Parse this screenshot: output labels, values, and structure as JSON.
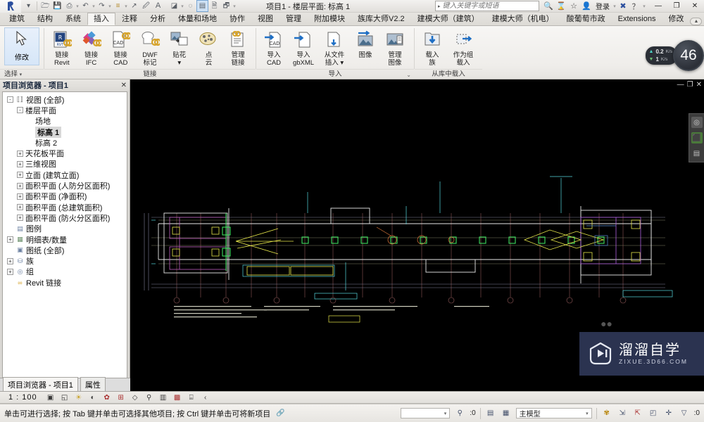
{
  "titlebar": {
    "logo": "revit-logo",
    "title": "项目1 - 楼层平面: 标高 1",
    "search_placeholder": "键入关键字或短语",
    "search_value": "",
    "signin_label": "登录",
    "qat_icons": [
      "open-icon",
      "save-icon",
      "print-icon",
      "undo-icon",
      "redo-icon",
      "measure-icon",
      "aligned-dimension-icon",
      "tag-icon",
      "text-icon",
      "section-icon",
      "thin-line-icon",
      "close-hidden-icon",
      "sync-icon",
      "switch-window-icon"
    ],
    "help_icon": "help-icon",
    "exchange_icon": "autodesk-exchange-icon",
    "window_buttons": [
      "minimize",
      "restore",
      "close"
    ]
  },
  "ribbon": {
    "tabs": [
      {
        "label": "建筑",
        "active": false
      },
      {
        "label": "结构",
        "active": false
      },
      {
        "label": "系统",
        "active": false
      },
      {
        "label": "插入",
        "active": true
      },
      {
        "label": "注释",
        "active": false
      },
      {
        "label": "分析",
        "active": false
      },
      {
        "label": "体量和场地",
        "active": false
      },
      {
        "label": "协作",
        "active": false
      },
      {
        "label": "视图",
        "active": false
      },
      {
        "label": "管理",
        "active": false
      },
      {
        "label": "附加模块",
        "active": false
      },
      {
        "label": "族库大师V2.2",
        "active": false
      },
      {
        "label": "建模大师（建筑）",
        "active": false
      },
      {
        "label": "建模大师（机电）",
        "active": false
      },
      {
        "label": "酸葡萄市政",
        "active": false
      },
      {
        "label": "Extensions",
        "active": false
      },
      {
        "label": "修改",
        "active": false
      }
    ],
    "modify_button": {
      "label": "修改",
      "icon": "arrow-cursor-icon"
    },
    "select_panel_label": "选择",
    "panels": [
      {
        "label": "链接",
        "has_launcher": false,
        "commands": [
          {
            "label": "链接\nRevit",
            "icon": "link-revit-icon"
          },
          {
            "label": "链接\nIFC",
            "icon": "link-ifc-icon"
          },
          {
            "label": "链接\nCAD",
            "icon": "link-cad-icon"
          },
          {
            "label": "DWF\n标记",
            "icon": "dwf-markup-icon"
          },
          {
            "label": "贴花\n▾",
            "icon": "decal-icon"
          },
          {
            "label": "点\n云",
            "icon": "point-cloud-icon"
          },
          {
            "label": "管理\n链接",
            "icon": "manage-links-icon"
          }
        ]
      },
      {
        "label": "导入",
        "has_launcher": true,
        "commands": [
          {
            "label": "导入\nCAD",
            "icon": "import-cad-icon"
          },
          {
            "label": "导入\ngbXML",
            "icon": "import-gbxml-icon"
          },
          {
            "label": "从文件\n插入 ▾",
            "icon": "insert-from-file-icon"
          },
          {
            "label": "图像",
            "icon": "image-icon"
          },
          {
            "label": "管理\n图像",
            "icon": "manage-images-icon"
          }
        ]
      },
      {
        "label": "从库中载入",
        "has_launcher": false,
        "commands": [
          {
            "label": "载入\n族",
            "icon": "load-family-icon"
          },
          {
            "label": "作为组\n载入",
            "icon": "load-as-group-icon"
          }
        ]
      }
    ]
  },
  "net_widget": {
    "upload": "0.2",
    "upload_unit": "K/s",
    "download": "1",
    "download_unit": "K/s",
    "badge": "46"
  },
  "browser": {
    "title": "项目浏览器 - 项目1",
    "close_icon": "close-icon",
    "nodes": [
      {
        "label": "视图 (全部)",
        "indent": 0,
        "expander": "-",
        "icon": "view-icon",
        "selected": false
      },
      {
        "label": "楼层平面",
        "indent": 1,
        "expander": "-",
        "icon": "",
        "selected": false
      },
      {
        "label": "场地",
        "indent": 2,
        "expander": "",
        "icon": "",
        "selected": false
      },
      {
        "label": "标高 1",
        "indent": 2,
        "expander": "",
        "icon": "",
        "selected": true
      },
      {
        "label": "标高 2",
        "indent": 2,
        "expander": "",
        "icon": "",
        "selected": false
      },
      {
        "label": "天花板平面",
        "indent": 1,
        "expander": "+",
        "icon": "",
        "selected": false
      },
      {
        "label": "三维视图",
        "indent": 1,
        "expander": "+",
        "icon": "",
        "selected": false
      },
      {
        "label": "立面 (建筑立面)",
        "indent": 1,
        "expander": "+",
        "icon": "",
        "selected": false
      },
      {
        "label": "面积平面 (人防分区面积)",
        "indent": 1,
        "expander": "+",
        "icon": "",
        "selected": false
      },
      {
        "label": "面积平面 (净面积)",
        "indent": 1,
        "expander": "+",
        "icon": "",
        "selected": false
      },
      {
        "label": "面积平面 (总建筑面积)",
        "indent": 1,
        "expander": "+",
        "icon": "",
        "selected": false
      },
      {
        "label": "面积平面 (防火分区面积)",
        "indent": 1,
        "expander": "+",
        "icon": "",
        "selected": false
      },
      {
        "label": "图例",
        "indent": 0,
        "expander": "",
        "icon": "legend-icon",
        "selected": false
      },
      {
        "label": "明细表/数量",
        "indent": 0,
        "expander": "+",
        "icon": "schedule-icon",
        "selected": false
      },
      {
        "label": "图纸 (全部)",
        "indent": 0,
        "expander": "",
        "icon": "sheet-icon",
        "selected": false
      },
      {
        "label": "族",
        "indent": 0,
        "expander": "+",
        "icon": "family-icon",
        "selected": false
      },
      {
        "label": "组",
        "indent": 0,
        "expander": "+",
        "icon": "group-icon",
        "selected": false
      },
      {
        "label": "Revit 链接",
        "indent": 0,
        "expander": "",
        "icon": "revit-links-icon",
        "selected": false
      }
    ],
    "tabs": [
      {
        "label": "项目浏览器 - 项目1",
        "active": true
      },
      {
        "label": "属性",
        "active": false
      }
    ]
  },
  "canvas": {
    "window_buttons": [
      "minimize",
      "restore",
      "close"
    ],
    "side_toolbar": [
      "camera-icon",
      "green-tag-icon",
      "list-icon"
    ],
    "watermark": {
      "main": "溜溜自学",
      "sub": "ZIXUE.3D66.COM",
      "play_icon": "play-logo-icon"
    }
  },
  "viewbar": {
    "scale": "1 : 100",
    "icons": [
      "detail-level-icon",
      "visual-style-icon",
      "sun-path-icon",
      "shadows-icon",
      "render-dialog-icon",
      "crop-view-icon",
      "show-crop-icon",
      "hide-analytical-icon",
      "temp-hide-isolate-icon",
      "reveal-hidden-icon",
      "worksharing-icon",
      "expand-icon"
    ]
  },
  "statusbar": {
    "hint": "单击可进行选择; 按 Tab 键并单击可选择其他项目; 按 Ctrl 键并单击可将新项目",
    "press_drag_icon": "press-drag-icon",
    "model_count": ":0",
    "design_options": "主模型",
    "filter_count": ":0",
    "right_icons": [
      "worksets-icon",
      "design-options-icon",
      "editing-requests-icon",
      "exclude-options-icon",
      "select-links-icon",
      "filter-icon"
    ]
  }
}
